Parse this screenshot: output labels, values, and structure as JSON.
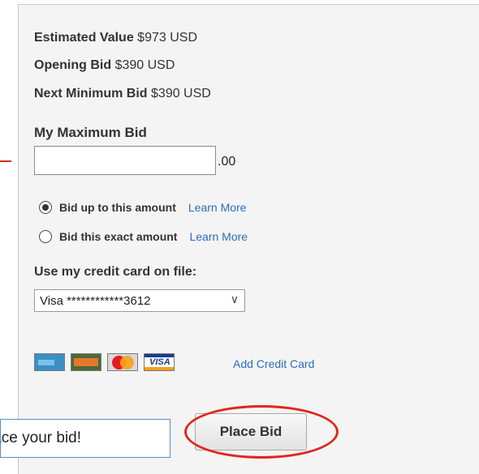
{
  "details": {
    "estimated_value": {
      "label": "Estimated Value",
      "value": "$973 USD"
    },
    "opening_bid": {
      "label": "Opening Bid",
      "value": "$390 USD"
    },
    "next_minimum_bid": {
      "label": "Next Minimum Bid",
      "value": "$390 USD"
    }
  },
  "max_bid": {
    "heading": "My Maximum Bid",
    "value": "",
    "placeholder": "",
    "cents": ".00"
  },
  "bid_options": [
    {
      "label": "Bid up to this amount",
      "link": "Learn More",
      "selected": true
    },
    {
      "label": "Bid this exact amount",
      "link": "Learn More",
      "selected": false
    }
  ],
  "card_on_file": {
    "heading": "Use my credit card on file:",
    "selected": "Visa ************3612"
  },
  "accepted_cards": {
    "icons": [
      "amex-card-icon",
      "discover-card-icon",
      "mastercard-icon",
      "visa-card-icon"
    ],
    "visa_text": "VISA",
    "add_link": "Add Credit Card"
  },
  "actions": {
    "place_bid": "Place Bid",
    "callout": "lace your bid!"
  },
  "colors": {
    "link": "#2a6ebb",
    "annotation_red": "#e0261e",
    "panel_bg": "#f4f4f4"
  }
}
